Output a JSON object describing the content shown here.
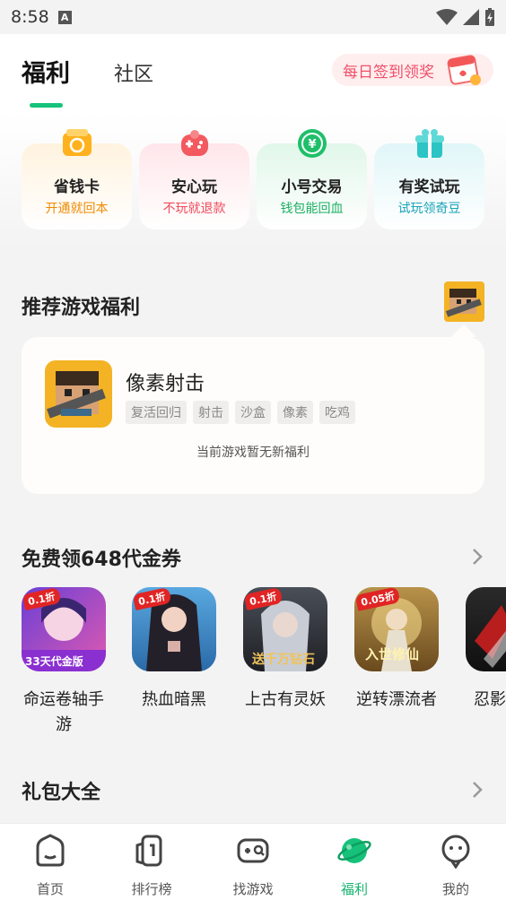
{
  "status_bar": {
    "time": "8:58",
    "notif_letter": "A"
  },
  "header": {
    "tab_active": "福利",
    "tab_other": "社区",
    "checkin_label": "每日签到领奖"
  },
  "entries": [
    {
      "title": "省钱卡",
      "subtitle": "开通就回本",
      "icon": "money-card-icon",
      "sub_color": "#f08a00"
    },
    {
      "title": "安心玩",
      "subtitle": "不玩就退款",
      "icon": "gamepad-heart-icon",
      "sub_color": "#f04b5a"
    },
    {
      "title": "小号交易",
      "subtitle": "钱包能回血",
      "icon": "yuan-coin-icon",
      "sub_color": "#1aae62"
    },
    {
      "title": "有奖试玩",
      "subtitle": "试玩领奇豆",
      "icon": "gift-box-icon",
      "sub_color": "#1aa2b8"
    }
  ],
  "recommend": {
    "title": "推荐游戏福利",
    "game_name": "像素射击",
    "tags": [
      "复活回归",
      "射击",
      "沙盒",
      "像素",
      "吃鸡"
    ],
    "empty_text": "当前游戏暂无新福利"
  },
  "coupons": {
    "title": "免费领648代金券",
    "games": [
      {
        "name": "命运卷轴手游",
        "badge": "0.1折",
        "art_text": "33天代金版"
      },
      {
        "name": "热血暗黑",
        "badge": "0.1折",
        "art_text": ""
      },
      {
        "name": "上古有灵妖",
        "badge": "0.1折",
        "art_text": "送千万钻石"
      },
      {
        "name": "逆转漂流者",
        "badge": "0.05折",
        "art_text": "入世修仙"
      },
      {
        "name": "忍影",
        "badge": "",
        "art_text": ""
      }
    ]
  },
  "gifts": {
    "title": "礼包大全"
  },
  "bottom_nav": [
    {
      "label": "首页",
      "icon": "home-icon"
    },
    {
      "label": "排行榜",
      "icon": "ranking-icon"
    },
    {
      "label": "找游戏",
      "icon": "find-game-icon"
    },
    {
      "label": "福利",
      "icon": "welfare-planet-icon",
      "active": true
    },
    {
      "label": "我的",
      "icon": "profile-icon"
    }
  ],
  "colors": {
    "accent_green": "#16c27a",
    "checkin_red": "#f0506a"
  }
}
